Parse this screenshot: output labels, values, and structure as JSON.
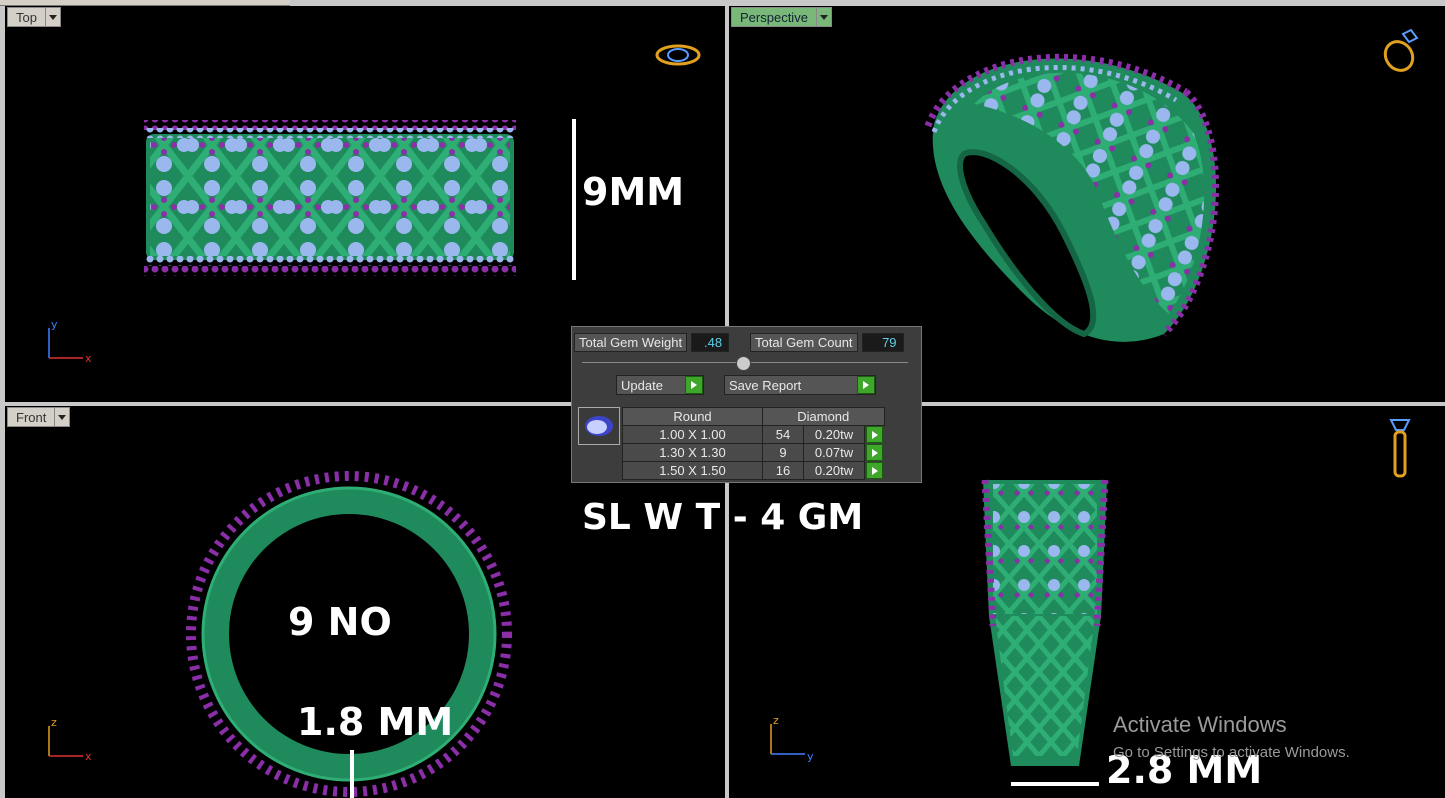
{
  "viewports": {
    "top": {
      "label": "Top"
    },
    "perspective": {
      "label": "Perspective"
    },
    "front": {
      "label": "Front"
    },
    "right": {
      "label": ""
    }
  },
  "axes": {
    "top": {
      "v": "y",
      "h": "x"
    },
    "front": {
      "v": "z",
      "h": "x"
    },
    "right": {
      "v": "z",
      "h": "y"
    }
  },
  "annotations": {
    "height": "9MM",
    "ring_size": "9 NO",
    "thickness": "1.8 MM",
    "silver_weight": "SL W T - 4 GM",
    "width": "2.8 MM"
  },
  "gem_panel": {
    "total_weight_label": "Total Gem Weight",
    "total_weight_value": ".48",
    "total_count_label": "Total Gem Count",
    "total_count_value": "79",
    "update_label": "Update",
    "save_report_label": "Save Report",
    "table_header": [
      "Round",
      "Diamond"
    ],
    "rows": [
      {
        "size": "1.00 X 1.00",
        "count": "54",
        "weight": "0.20tw"
      },
      {
        "size": "1.30 X 1.30",
        "count": "9",
        "weight": "0.07tw"
      },
      {
        "size": "1.50 X 1.50",
        "count": "16",
        "weight": "0.20tw"
      }
    ]
  },
  "watermark": {
    "title": "Activate Windows",
    "subtitle": "Go to Settings to activate Windows."
  },
  "colors": {
    "metal": "#1f8a5c",
    "gem": "#9ab8ee",
    "accent_bead": "#8a2fa8",
    "viewport_bg": "#000000",
    "active_tab": "#79b879"
  }
}
